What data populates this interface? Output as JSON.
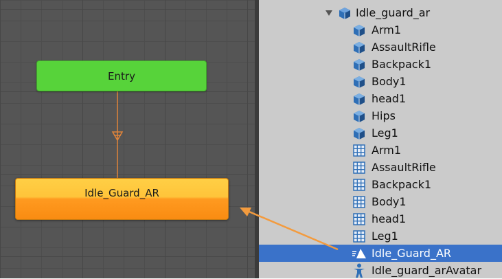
{
  "graph": {
    "entry_label": "Entry",
    "state_label": "Idle_Guard_AR",
    "colors": {
      "background": "#555555",
      "entry": "#57d33a",
      "state": "#ffa526",
      "transition": "#f08a2e"
    }
  },
  "project": {
    "root": {
      "label": "Idle_guard_ar",
      "icon": "prefab-cube-icon",
      "expanded": true
    },
    "items": [
      {
        "label": "Arm1",
        "icon": "cube-icon"
      },
      {
        "label": "AssaultRifle",
        "icon": "cube-icon"
      },
      {
        "label": "Backpack1",
        "icon": "cube-icon"
      },
      {
        "label": "Body1",
        "icon": "cube-icon"
      },
      {
        "label": "head1",
        "icon": "cube-icon"
      },
      {
        "label": "Hips",
        "icon": "cube-icon"
      },
      {
        "label": "Leg1",
        "icon": "cube-icon"
      },
      {
        "label": "Arm1",
        "icon": "mesh-grid-icon"
      },
      {
        "label": "AssaultRifle",
        "icon": "mesh-grid-icon"
      },
      {
        "label": "Backpack1",
        "icon": "mesh-grid-icon"
      },
      {
        "label": "Body1",
        "icon": "mesh-grid-icon"
      },
      {
        "label": "head1",
        "icon": "mesh-grid-icon"
      },
      {
        "label": "Leg1",
        "icon": "mesh-grid-icon"
      },
      {
        "label": "Idle_Guard_AR",
        "icon": "animation-clip-icon",
        "selected": true
      },
      {
        "label": "Idle_guard_arAvatar",
        "icon": "avatar-icon"
      }
    ],
    "colors": {
      "panel": "#cbcbcb",
      "selection": "#3a72c9",
      "cube": "#2f6fb6"
    }
  },
  "annotation": {
    "color": "#f39b3e"
  }
}
